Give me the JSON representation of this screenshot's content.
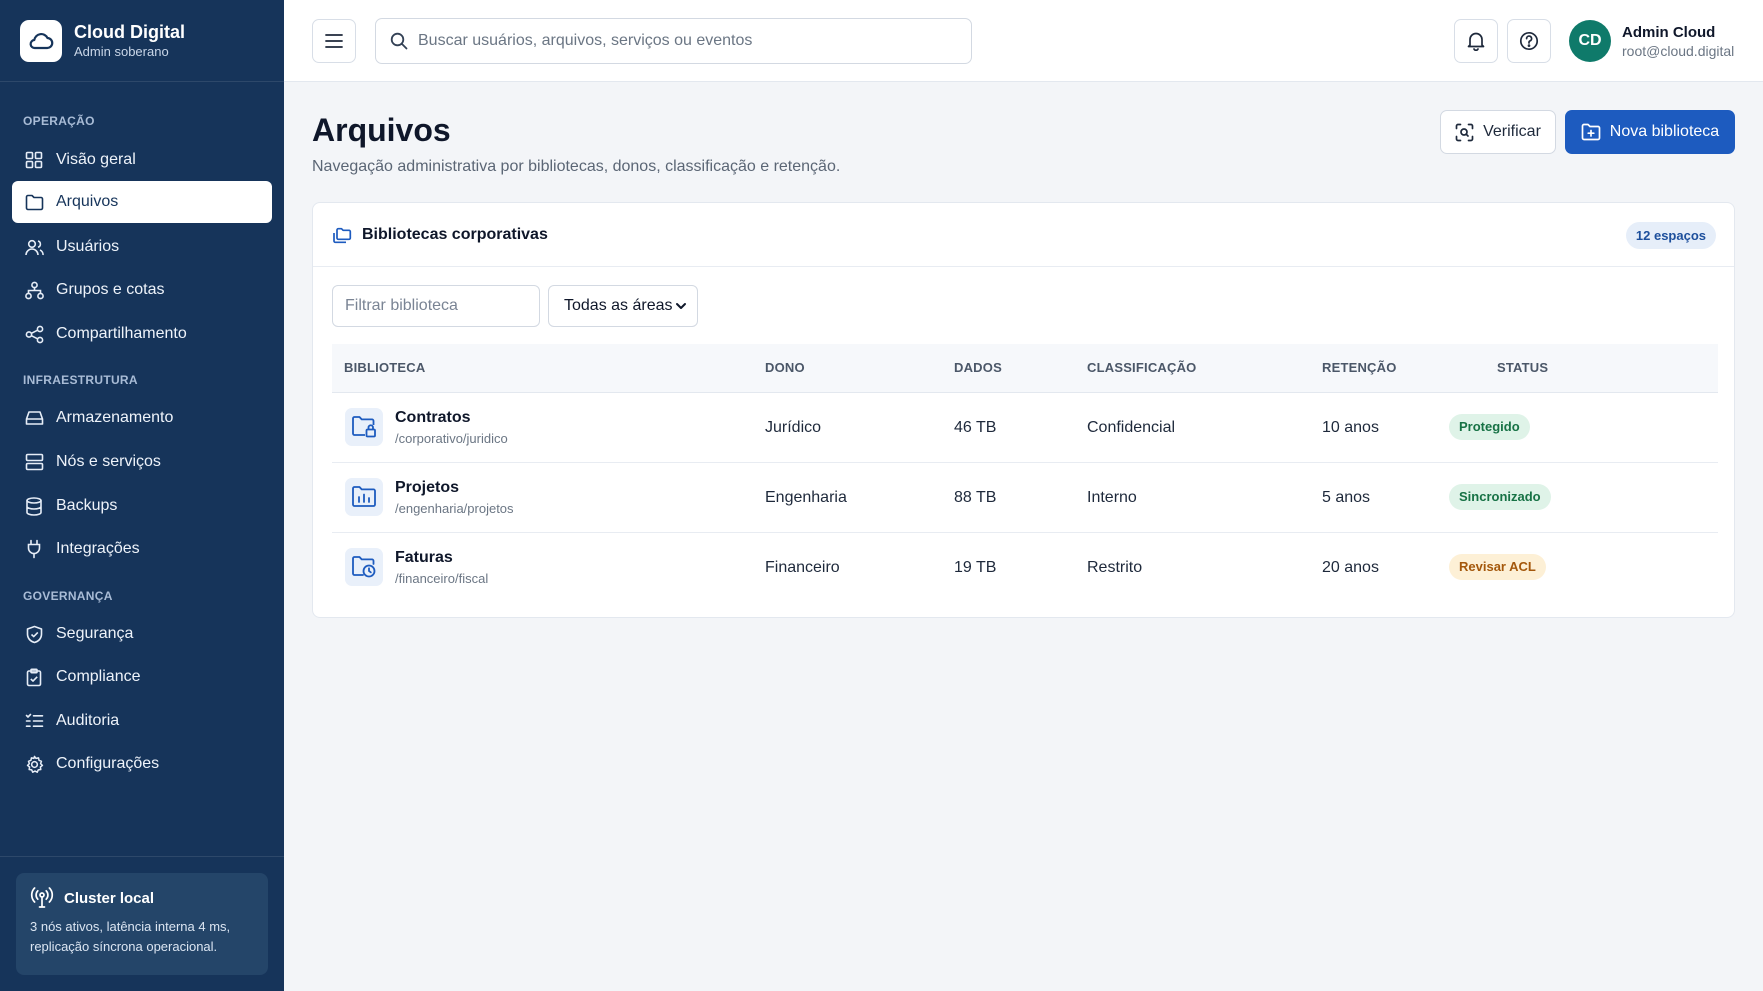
{
  "brand": {
    "title": "Cloud Digital",
    "subtitle": "Admin soberano"
  },
  "sidebar": {
    "sections": [
      {
        "label": "OPERAÇÃO"
      },
      {
        "label": "INFRAESTRUTURA"
      },
      {
        "label": "GOVERNANÇA"
      }
    ],
    "items": [
      {
        "label": "Visão geral",
        "icon": "grid-icon"
      },
      {
        "label": "Arquivos",
        "icon": "folder-icon",
        "active": true
      },
      {
        "label": "Usuários",
        "icon": "users-icon"
      },
      {
        "label": "Grupos e cotas",
        "icon": "hierarchy-icon"
      },
      {
        "label": "Compartilhamento",
        "icon": "share-icon"
      },
      {
        "label": "Armazenamento",
        "icon": "drive-icon"
      },
      {
        "label": "Nós e serviços",
        "icon": "server-icon"
      },
      {
        "label": "Backups",
        "icon": "database-icon"
      },
      {
        "label": "Integrações",
        "icon": "plug-icon"
      },
      {
        "label": "Segurança",
        "icon": "shield-icon"
      },
      {
        "label": "Compliance",
        "icon": "clipboard-check-icon"
      },
      {
        "label": "Auditoria",
        "icon": "checklist-icon"
      },
      {
        "label": "Configurações",
        "icon": "gear-icon"
      }
    ],
    "cluster": {
      "title": "Cluster local",
      "text": "3 nós ativos, latência interna 4 ms, replicação síncrona operacional.",
      "icon": "antenna-icon"
    }
  },
  "topbar": {
    "search_placeholder": "Buscar usuários, arquivos, serviços ou eventos",
    "user": {
      "initials": "CD",
      "name": "Admin Cloud",
      "email": "root@cloud.digital"
    }
  },
  "page": {
    "title": "Arquivos",
    "subtitle": "Navegação administrativa por bibliotecas, donos, classificação e retenção.",
    "verify_label": "Verificar",
    "new_label": "Nova biblioteca"
  },
  "card": {
    "title": "Bibliotecas corporativas",
    "badge": "12 espaços",
    "filter_placeholder": "Filtrar biblioteca",
    "area_selected": "Todas as áreas",
    "columns": [
      "BIBLIOTECA",
      "DONO",
      "DADOS",
      "CLASSIFICAÇÃO",
      "RETENÇÃO",
      "STATUS"
    ],
    "rows": [
      {
        "name": "Contratos",
        "path": "/corporativo/juridico",
        "owner": "Jurídico",
        "data": "46 TB",
        "classification": "Confidencial",
        "retention": "10 anos",
        "status": "Protegido",
        "icon": "folder-lock-icon"
      },
      {
        "name": "Projetos",
        "path": "/engenharia/projetos",
        "owner": "Engenharia",
        "data": "88 TB",
        "classification": "Interno",
        "retention": "5 anos",
        "status": "Sincronizado",
        "icon": "folder-chart-icon"
      },
      {
        "name": "Faturas",
        "path": "/financeiro/fiscal",
        "owner": "Financeiro",
        "data": "19 TB",
        "classification": "Restrito",
        "retention": "20 anos",
        "status": "Revisar ACL",
        "icon": "folder-clock-icon"
      }
    ]
  },
  "colors": {
    "sidebar_bg": "#16345a",
    "primary": "#1d5bbf",
    "avatar": "#0f7a6a",
    "status_green_bg": "#dff3e8",
    "status_green_text": "#177245",
    "status_amber_bg": "#fdf0d6",
    "status_amber_text": "#a4580c"
  }
}
